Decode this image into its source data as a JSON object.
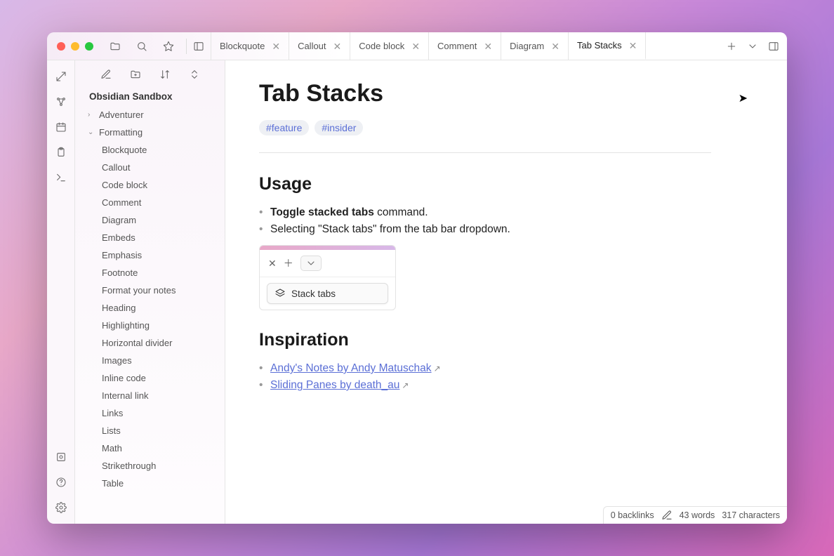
{
  "tabs": [
    {
      "label": "Blockquote",
      "active": false
    },
    {
      "label": "Callout",
      "active": false
    },
    {
      "label": "Code block",
      "active": false
    },
    {
      "label": "Comment",
      "active": false
    },
    {
      "label": "Diagram",
      "active": false
    },
    {
      "label": "Tab Stacks",
      "active": true
    }
  ],
  "vault_title": "Obsidian Sandbox",
  "tree": {
    "folders": [
      {
        "name": "Adventurer",
        "expanded": false
      },
      {
        "name": "Formatting",
        "expanded": true
      }
    ],
    "formatting_children": [
      "Blockquote",
      "Callout",
      "Code block",
      "Comment",
      "Diagram",
      "Embeds",
      "Emphasis",
      "Footnote",
      "Format your notes",
      "Heading",
      "Highlighting",
      "Horizontal divider",
      "Images",
      "Inline code",
      "Internal link",
      "Links",
      "Lists",
      "Math",
      "Strikethrough",
      "Table"
    ]
  },
  "doc": {
    "title": "Tab Stacks",
    "tags": [
      "#feature",
      "#insider"
    ],
    "h_usage": "Usage",
    "usage_bold": "Toggle stacked tabs",
    "usage_rest": " command.",
    "usage_line2": "Selecting \"Stack tabs\" from the tab bar dropdown.",
    "embed_menu_label": "Stack tabs",
    "h_inspiration": "Inspiration",
    "link1": "Andy's Notes by Andy Matuschak",
    "link2": "Sliding Panes by death_au"
  },
  "status": {
    "backlinks": "0 backlinks",
    "words": "43 words",
    "chars": "317 characters"
  }
}
